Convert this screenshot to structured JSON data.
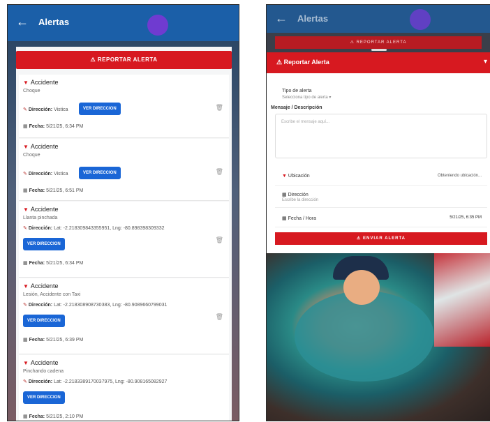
{
  "left_screen": {
    "title": "Alertas",
    "back_icon": "arrow-left-icon",
    "report_button": "REPORTAR ALERTA",
    "ver_label": "VER DIRECCION",
    "alerts": [
      {
        "type": "Accidente",
        "detail": "Choque",
        "dir_label": "Dirección:",
        "dir_value": "Vistica",
        "fecha_label": "Fecha:",
        "fecha_value": "5/21/25, 6:34 PM"
      },
      {
        "type": "Accidente",
        "detail": "Choque",
        "dir_label": "Dirección:",
        "dir_value": "Vistica",
        "fecha_label": "Fecha:",
        "fecha_value": "5/21/25, 6:51 PM"
      },
      {
        "type": "Accidente",
        "detail": "Llanta pinchada",
        "dir_label": "Dirección:",
        "dir_value": "Lat: -2.218309843355951, Lng: -80.898398309332",
        "fecha_label": "Fecha:",
        "fecha_value": "5/21/25, 6:34 PM"
      },
      {
        "type": "Accidente",
        "detail": "Lesión, Accidente con Taxi",
        "dir_label": "Dirección:",
        "dir_value": "Lat: -2.218308908730383, Lng: -80.9089660799031",
        "fecha_label": "Fecha:",
        "fecha_value": "5/21/25, 6:39 PM"
      },
      {
        "type": "Accidente",
        "detail": "Pinchando cadena",
        "dir_label": "Dirección:",
        "dir_value": "Lat: -2.2183389170037975, Lng: -80.908165082927",
        "fecha_label": "Fecha:",
        "fecha_value": "5/21/25, 2:10 PM"
      }
    ]
  },
  "right_screen": {
    "title": "Alertas",
    "top_button": "REPORTAR ALERTA",
    "sheet_title": "Reportar Alerta",
    "tipo_label": "Tipo de alerta",
    "tipo_placeholder": "Selecciona tipo de alerta",
    "mensaje_label": "Mensaje / Descripción",
    "mensaje_placeholder": "Escribe el mensaje aquí...",
    "ubicacion_label": "Ubicación",
    "ubicacion_value": "Obteniendo ubicación...",
    "direccion_label": "Dirección",
    "direccion_placeholder": "Escribe la dirección",
    "fecha_label": "Fecha / Hora",
    "fecha_value": "5/21/25, 6:35 PM",
    "send_button": "ENVIAR ALERTA"
  }
}
